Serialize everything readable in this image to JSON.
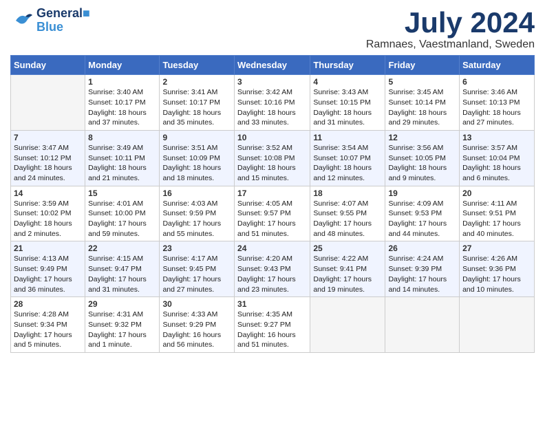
{
  "header": {
    "logo_general": "General",
    "logo_blue": "Blue",
    "month_title": "July 2024",
    "location": "Ramnaes, Vaestmanland, Sweden"
  },
  "days_of_week": [
    "Sunday",
    "Monday",
    "Tuesday",
    "Wednesday",
    "Thursday",
    "Friday",
    "Saturday"
  ],
  "weeks": [
    [
      {
        "day": "",
        "info": ""
      },
      {
        "day": "1",
        "info": "Sunrise: 3:40 AM\nSunset: 10:17 PM\nDaylight: 18 hours\nand 37 minutes."
      },
      {
        "day": "2",
        "info": "Sunrise: 3:41 AM\nSunset: 10:17 PM\nDaylight: 18 hours\nand 35 minutes."
      },
      {
        "day": "3",
        "info": "Sunrise: 3:42 AM\nSunset: 10:16 PM\nDaylight: 18 hours\nand 33 minutes."
      },
      {
        "day": "4",
        "info": "Sunrise: 3:43 AM\nSunset: 10:15 PM\nDaylight: 18 hours\nand 31 minutes."
      },
      {
        "day": "5",
        "info": "Sunrise: 3:45 AM\nSunset: 10:14 PM\nDaylight: 18 hours\nand 29 minutes."
      },
      {
        "day": "6",
        "info": "Sunrise: 3:46 AM\nSunset: 10:13 PM\nDaylight: 18 hours\nand 27 minutes."
      }
    ],
    [
      {
        "day": "7",
        "info": "Sunrise: 3:47 AM\nSunset: 10:12 PM\nDaylight: 18 hours\nand 24 minutes."
      },
      {
        "day": "8",
        "info": "Sunrise: 3:49 AM\nSunset: 10:11 PM\nDaylight: 18 hours\nand 21 minutes."
      },
      {
        "day": "9",
        "info": "Sunrise: 3:51 AM\nSunset: 10:09 PM\nDaylight: 18 hours\nand 18 minutes."
      },
      {
        "day": "10",
        "info": "Sunrise: 3:52 AM\nSunset: 10:08 PM\nDaylight: 18 hours\nand 15 minutes."
      },
      {
        "day": "11",
        "info": "Sunrise: 3:54 AM\nSunset: 10:07 PM\nDaylight: 18 hours\nand 12 minutes."
      },
      {
        "day": "12",
        "info": "Sunrise: 3:56 AM\nSunset: 10:05 PM\nDaylight: 18 hours\nand 9 minutes."
      },
      {
        "day": "13",
        "info": "Sunrise: 3:57 AM\nSunset: 10:04 PM\nDaylight: 18 hours\nand 6 minutes."
      }
    ],
    [
      {
        "day": "14",
        "info": "Sunrise: 3:59 AM\nSunset: 10:02 PM\nDaylight: 18 hours\nand 2 minutes."
      },
      {
        "day": "15",
        "info": "Sunrise: 4:01 AM\nSunset: 10:00 PM\nDaylight: 17 hours\nand 59 minutes."
      },
      {
        "day": "16",
        "info": "Sunrise: 4:03 AM\nSunset: 9:59 PM\nDaylight: 17 hours\nand 55 minutes."
      },
      {
        "day": "17",
        "info": "Sunrise: 4:05 AM\nSunset: 9:57 PM\nDaylight: 17 hours\nand 51 minutes."
      },
      {
        "day": "18",
        "info": "Sunrise: 4:07 AM\nSunset: 9:55 PM\nDaylight: 17 hours\nand 48 minutes."
      },
      {
        "day": "19",
        "info": "Sunrise: 4:09 AM\nSunset: 9:53 PM\nDaylight: 17 hours\nand 44 minutes."
      },
      {
        "day": "20",
        "info": "Sunrise: 4:11 AM\nSunset: 9:51 PM\nDaylight: 17 hours\nand 40 minutes."
      }
    ],
    [
      {
        "day": "21",
        "info": "Sunrise: 4:13 AM\nSunset: 9:49 PM\nDaylight: 17 hours\nand 36 minutes."
      },
      {
        "day": "22",
        "info": "Sunrise: 4:15 AM\nSunset: 9:47 PM\nDaylight: 17 hours\nand 31 minutes."
      },
      {
        "day": "23",
        "info": "Sunrise: 4:17 AM\nSunset: 9:45 PM\nDaylight: 17 hours\nand 27 minutes."
      },
      {
        "day": "24",
        "info": "Sunrise: 4:20 AM\nSunset: 9:43 PM\nDaylight: 17 hours\nand 23 minutes."
      },
      {
        "day": "25",
        "info": "Sunrise: 4:22 AM\nSunset: 9:41 PM\nDaylight: 17 hours\nand 19 minutes."
      },
      {
        "day": "26",
        "info": "Sunrise: 4:24 AM\nSunset: 9:39 PM\nDaylight: 17 hours\nand 14 minutes."
      },
      {
        "day": "27",
        "info": "Sunrise: 4:26 AM\nSunset: 9:36 PM\nDaylight: 17 hours\nand 10 minutes."
      }
    ],
    [
      {
        "day": "28",
        "info": "Sunrise: 4:28 AM\nSunset: 9:34 PM\nDaylight: 17 hours\nand 5 minutes."
      },
      {
        "day": "29",
        "info": "Sunrise: 4:31 AM\nSunset: 9:32 PM\nDaylight: 17 hours\nand 1 minute."
      },
      {
        "day": "30",
        "info": "Sunrise: 4:33 AM\nSunset: 9:29 PM\nDaylight: 16 hours\nand 56 minutes."
      },
      {
        "day": "31",
        "info": "Sunrise: 4:35 AM\nSunset: 9:27 PM\nDaylight: 16 hours\nand 51 minutes."
      },
      {
        "day": "",
        "info": ""
      },
      {
        "day": "",
        "info": ""
      },
      {
        "day": "",
        "info": ""
      }
    ]
  ]
}
